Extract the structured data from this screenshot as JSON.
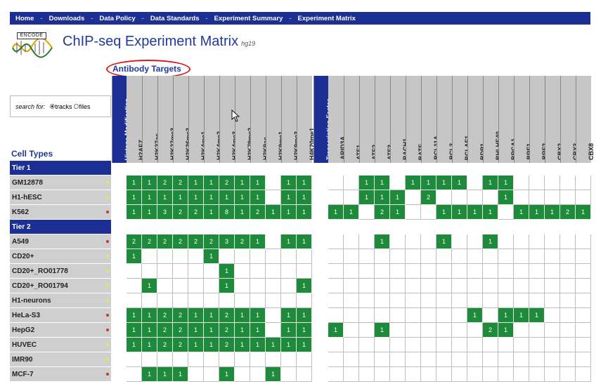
{
  "nav": [
    "Home",
    "Downloads",
    "Data Policy",
    "Data Standards",
    "Experiment Summary",
    "Experiment Matrix"
  ],
  "nav_separator": "-",
  "logo_text": "ENCODE",
  "title": "ChIP-seq Experiment Matrix",
  "assembly": "hg19",
  "antibody_title": "Antibody Targets",
  "search_label": "search for:",
  "search_options": [
    {
      "label": "tracks",
      "selected": true
    },
    {
      "label": "files",
      "selected": false
    }
  ],
  "cell_types_title": "Cell Types",
  "columns": [
    {
      "label": "Histone Modification",
      "group": true
    },
    {
      "label": "H2AFZ"
    },
    {
      "label": "H3K27ac"
    },
    {
      "label": "H3K27me3"
    },
    {
      "label": "H3K36me3"
    },
    {
      "label": "H3K4me1"
    },
    {
      "label": "H3K4me2"
    },
    {
      "label": "H3K4me3"
    },
    {
      "label": "H3K79me2"
    },
    {
      "label": "H3K9ac"
    },
    {
      "label": "H3K9me1"
    },
    {
      "label": "H3K9me3"
    },
    {
      "label": "H4K20me1"
    },
    {
      "label": "Transcription Factor",
      "group": true
    },
    {
      "label": "ARID3A"
    },
    {
      "label": "ATF1"
    },
    {
      "label": "ATF2"
    },
    {
      "label": "ATF3"
    },
    {
      "label": "BACH1"
    },
    {
      "label": "BATF"
    },
    {
      "label": "BCL11A"
    },
    {
      "label": "BCL3"
    },
    {
      "label": "BCLAF1"
    },
    {
      "label": "BDP1"
    },
    {
      "label": "BHLHE40"
    },
    {
      "label": "BRCA1"
    },
    {
      "label": "BRF1"
    },
    {
      "label": "BRF2"
    },
    {
      "label": "CBX2"
    },
    {
      "label": "CBX3"
    },
    {
      "label": "CBX8"
    }
  ],
  "rows": [
    {
      "label": "Tier 1",
      "tier": true
    },
    {
      "label": "GM12878",
      "dot": "#e9e94a",
      "histone": [
        "1",
        "1",
        "2",
        "2",
        "1",
        "1",
        "2",
        "1",
        "1",
        "",
        "1",
        "1"
      ],
      "tf": [
        "",
        "",
        "1",
        "1",
        "",
        "1",
        "1",
        "1",
        "1",
        "",
        "1",
        "1",
        "",
        "",
        "",
        "",
        ""
      ]
    },
    {
      "label": "H1-hESC",
      "dot": "#e9e94a",
      "histone": [
        "1",
        "1",
        "1",
        "1",
        "1",
        "1",
        "1",
        "1",
        "1",
        "",
        "1",
        "1"
      ],
      "tf": [
        "",
        "",
        "1",
        "1",
        "1",
        "",
        "2",
        "",
        "",
        "",
        "",
        "1",
        "",
        "",
        "",
        "",
        ""
      ]
    },
    {
      "label": "K562",
      "dot": "#c0392b",
      "histone": [
        "1",
        "1",
        "3",
        "2",
        "2",
        "1",
        "8",
        "1",
        "2",
        "1",
        "1",
        "1"
      ],
      "tf": [
        "1",
        "1",
        "",
        "2",
        "1",
        "",
        "",
        "1",
        "1",
        "1",
        "1",
        "",
        "1",
        "1",
        "1",
        "2",
        "1"
      ]
    },
    {
      "label": "Tier 2",
      "tier": true
    },
    {
      "label": "A549",
      "dot": "#c0392b",
      "histone": [
        "2",
        "2",
        "2",
        "2",
        "2",
        "2",
        "3",
        "2",
        "1",
        "",
        "1",
        "1"
      ],
      "tf": [
        "",
        "",
        "",
        "1",
        "",
        "",
        "",
        "1",
        "",
        "",
        "1",
        "",
        "",
        "",
        "",
        "",
        ""
      ]
    },
    {
      "label": "CD20+",
      "dot": "#e9e94a",
      "histone": [
        "1",
        "",
        "",
        "",
        "",
        "1",
        "",
        "",
        "",
        "",
        "",
        ""
      ],
      "tf": [
        "",
        "",
        "",
        "",
        "",
        "",
        "",
        "",
        "",
        "",
        "",
        "",
        "",
        "",
        "",
        "",
        ""
      ]
    },
    {
      "label": "CD20+_RO01778",
      "dot": "#e9e94a",
      "histone": [
        "",
        "",
        "",
        "",
        "",
        "",
        "1",
        "",
        "",
        "",
        "",
        ""
      ],
      "tf": [
        "",
        "",
        "",
        "",
        "",
        "",
        "",
        "",
        "",
        "",
        "",
        "",
        "",
        "",
        "",
        "",
        ""
      ]
    },
    {
      "label": "CD20+_RO01794",
      "dot": "#e9e94a",
      "histone": [
        "",
        "1",
        "",
        "",
        "",
        "",
        "1",
        "",
        "",
        "",
        "",
        "1"
      ],
      "tf": [
        "",
        "",
        "",
        "",
        "",
        "",
        "",
        "",
        "",
        "",
        "",
        "",
        "",
        "",
        "",
        "",
        ""
      ]
    },
    {
      "label": "H1-neurons",
      "dot": "#e9e94a",
      "histone": [
        "",
        "",
        "",
        "",
        "",
        "",
        "",
        "",
        "",
        "",
        "",
        ""
      ],
      "tf": [
        "",
        "",
        "",
        "",
        "",
        "",
        "",
        "",
        "",
        "",
        "",
        "",
        "",
        "",
        "",
        "",
        ""
      ]
    },
    {
      "label": "HeLa-S3",
      "dot": "#c0392b",
      "histone": [
        "1",
        "1",
        "2",
        "2",
        "1",
        "1",
        "2",
        "1",
        "1",
        "",
        "1",
        "1"
      ],
      "tf": [
        "",
        "",
        "",
        "",
        "",
        "",
        "",
        "",
        "",
        "1",
        "",
        "1",
        "1",
        "1",
        "",
        "",
        ""
      ]
    },
    {
      "label": "HepG2",
      "dot": "#c0392b",
      "histone": [
        "1",
        "1",
        "2",
        "2",
        "1",
        "1",
        "2",
        "1",
        "1",
        "",
        "1",
        "1"
      ],
      "tf": [
        "1",
        "",
        "",
        "1",
        "",
        "",
        "",
        "",
        "",
        "",
        "2",
        "1",
        "",
        "",
        "",
        "",
        ""
      ]
    },
    {
      "label": "HUVEC",
      "dot": "#e9e94a",
      "histone": [
        "1",
        "1",
        "2",
        "2",
        "1",
        "1",
        "2",
        "1",
        "1",
        "1",
        "1",
        "1"
      ],
      "tf": [
        "",
        "",
        "",
        "",
        "",
        "",
        "",
        "",
        "",
        "",
        "",
        "",
        "",
        "",
        "",
        "",
        ""
      ]
    },
    {
      "label": "IMR90",
      "dot": "#e9e94a",
      "histone": [
        "",
        "",
        "",
        "",
        "",
        "",
        "",
        "",
        "",
        "",
        "",
        ""
      ],
      "tf": [
        "",
        "",
        "",
        "",
        "",
        "",
        "",
        "",
        "",
        "",
        "",
        "",
        "",
        "",
        "",
        "",
        ""
      ]
    },
    {
      "label": "MCF-7",
      "dot": "#c0392b",
      "histone": [
        "",
        "1",
        "1",
        "1",
        "",
        "",
        "1",
        "",
        "",
        "1",
        "",
        ""
      ],
      "tf": [
        "",
        "",
        "",
        "",
        "",
        "",
        "",
        "",
        "",
        "",
        "",
        "",
        "",
        "",
        "",
        "",
        ""
      ]
    }
  ],
  "colors": {
    "nav": "#1b2f94",
    "on": "#1e8a3b",
    "header": "#c6c6c6",
    "title": "#1f3a9c",
    "highlight": "#d81a1a"
  }
}
